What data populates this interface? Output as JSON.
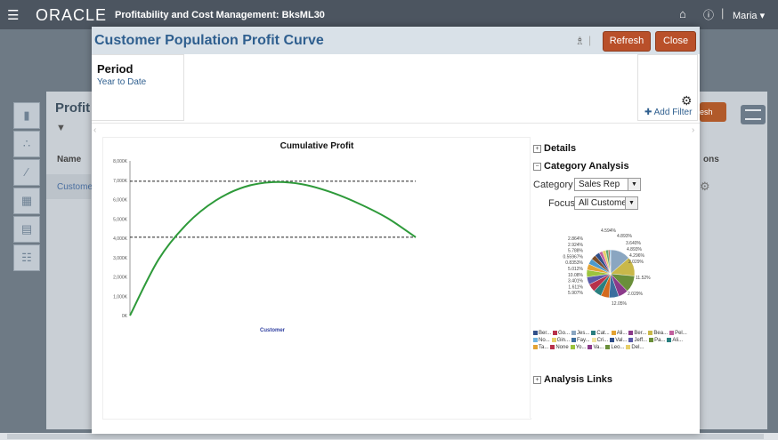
{
  "app": {
    "menu_icon": "hamburger-icon",
    "logo": "ORACLE",
    "title": "Profitability and Cost Management: BksML30",
    "user": "Maria",
    "home_icon": "home-icon",
    "info_icon": "info-icon"
  },
  "background_page": {
    "title": "Profit",
    "name_header": "Name",
    "row_name": "Custome",
    "options_header": "ons",
    "refresh_label": "esh"
  },
  "dialog": {
    "title": "Customer Population Profit Curve",
    "refresh_label": "Refresh",
    "close_label": "Close",
    "pov": {
      "period_label": "Period",
      "period_value": "Year to Date",
      "add_filter_label": "Add Filter"
    }
  },
  "chart_data": {
    "type": "line",
    "title": "Cumulative Profit",
    "xlabel": "Customer",
    "ylabel": "",
    "y_ticks": [
      "0K",
      "1,000K",
      "2,000K",
      "3,000K",
      "4,000K",
      "5,000K",
      "6,000K",
      "7,000K",
      "8,000K"
    ],
    "ylim": [
      0,
      8000
    ],
    "x": [
      0,
      0.1,
      0.2,
      0.3,
      0.4,
      0.5,
      0.6,
      0.7,
      0.8,
      0.9,
      1.0
    ],
    "values": [
      0,
      2900,
      4750,
      5950,
      6650,
      6900,
      6800,
      6400,
      5800,
      5050,
      4050
    ],
    "reference_lines": [
      6950,
      4050
    ],
    "series_color": "#2e9a3a"
  },
  "right_panel": {
    "details_label": "Details",
    "category_analysis_label": "Category Analysis",
    "category_label": "Category",
    "category_value": "Sales Rep",
    "focus_label": "Focus",
    "focus_value": "All Customer",
    "analysis_links_label": "Analysis Links",
    "pie": {
      "labels_left": [
        "2.864%",
        "2.924%",
        "5.788%",
        "0.55967%",
        "0.8353%",
        "5.012%",
        "10.08%",
        "3.401%",
        "1.611%",
        "5.907%"
      ],
      "labels_right": [
        "4.594%",
        "4.893%",
        "3.640%",
        "4.893%",
        "4.296%",
        "2.029%",
        "11.52%",
        "2.029%",
        "12.05%"
      ],
      "slices": [
        {
          "value": 12.05,
          "color": "#8aa6c1"
        },
        {
          "value": 11.52,
          "color": "#c9b84a"
        },
        {
          "value": 10.08,
          "color": "#6a8f3a"
        },
        {
          "value": 5.907,
          "color": "#8b3a8a"
        },
        {
          "value": 5.788,
          "color": "#3c6e9e"
        },
        {
          "value": 5.012,
          "color": "#d46a1e"
        },
        {
          "value": 4.893,
          "color": "#2a7f7f"
        },
        {
          "value": 4.893,
          "color": "#b8314a"
        },
        {
          "value": 4.594,
          "color": "#5a5aa8"
        },
        {
          "value": 4.296,
          "color": "#9cc43e"
        },
        {
          "value": 3.64,
          "color": "#e3a232"
        },
        {
          "value": 3.401,
          "color": "#4d9acb"
        },
        {
          "value": 2.924,
          "color": "#7d4e2a"
        },
        {
          "value": 2.864,
          "color": "#2f4f8a"
        },
        {
          "value": 2.029,
          "color": "#c2609e"
        },
        {
          "value": 2.029,
          "color": "#e7cf6a"
        },
        {
          "value": 1.611,
          "color": "#5fa86f"
        },
        {
          "value": 0.8353,
          "color": "#a0522d"
        },
        {
          "value": 0.55967,
          "color": "#6fb3e0"
        }
      ]
    },
    "legend": [
      {
        "label": "Ber...",
        "color": "#2f4f8a"
      },
      {
        "label": "Go...",
        "color": "#b8314a"
      },
      {
        "label": "Jes...",
        "color": "#8aa6c1"
      },
      {
        "label": "Cat...",
        "color": "#2a7f7f"
      },
      {
        "label": "Ali...",
        "color": "#e3a232"
      },
      {
        "label": "Ber...",
        "color": "#8b3a8a"
      },
      {
        "label": "Bea...",
        "color": "#c9b84a"
      },
      {
        "label": "Pel...",
        "color": "#c2609e"
      },
      {
        "label": "No...",
        "color": "#6fb3e0"
      },
      {
        "label": "Gin...",
        "color": "#e7cf6a"
      },
      {
        "label": "Fay...",
        "color": "#3c6e9e"
      },
      {
        "label": "Cri...",
        "color": "#f0e4a0"
      },
      {
        "label": "Val...",
        "color": "#2f4f8a"
      },
      {
        "label": "Jeff...",
        "color": "#5a5aa8"
      },
      {
        "label": "Pa...",
        "color": "#6a8f3a"
      },
      {
        "label": "Ali...",
        "color": "#2a7f7f"
      },
      {
        "label": "Ta...",
        "color": "#e3a232"
      },
      {
        "label": "None",
        "color": "#b8314a"
      },
      {
        "label": "Yo...",
        "color": "#9cc43e"
      },
      {
        "label": "Va...",
        "color": "#8b3a8a"
      },
      {
        "label": "Leo...",
        "color": "#6a8f3a"
      },
      {
        "label": "Del...",
        "color": "#e7cf6a"
      }
    ]
  }
}
